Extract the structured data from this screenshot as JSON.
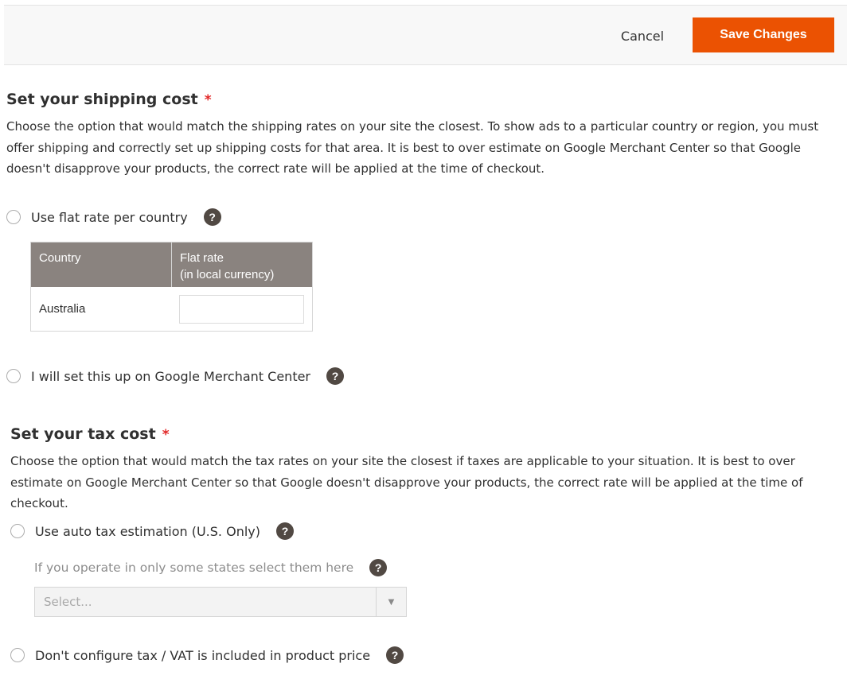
{
  "toolbar": {
    "cancel_label": "Cancel",
    "save_label": "Save Changes",
    "accent_color": "#eb5202"
  },
  "shipping": {
    "title": "Set your shipping cost",
    "required_marker": "*",
    "description": "Choose the option that would match the shipping rates on your site the closest. To show ads to a particular country or region, you must offer shipping and correctly set up shipping costs for that area. It is best to over estimate on Google Merchant Center so that Google doesn't disapprove your products, the correct rate will be applied at the time of checkout.",
    "option_flat_rate": "Use flat rate per country",
    "table": {
      "col_country": "Country",
      "col_rate_line1": "Flat rate",
      "col_rate_line2": "(in local currency)",
      "rows": [
        {
          "country": "Australia",
          "rate": ""
        }
      ]
    },
    "option_merchant_center": "I will set this up on Google Merchant Center"
  },
  "tax": {
    "title": "Set your tax cost",
    "required_marker": "*",
    "description": "Choose the option that would match the tax rates on your site the closest if taxes are applicable to your situation. It is best to over estimate on Google Merchant Center so that Google doesn't disapprove your products, the correct rate will be applied at the time of checkout.",
    "option_auto": "Use auto tax estimation (U.S. Only)",
    "states_label": "If you operate in only some states select them here",
    "states_placeholder": "Select...",
    "option_no_config": "Don't configure tax / VAT is included in product price"
  },
  "icons": {
    "help_glyph": "?",
    "dropdown_glyph": "▼"
  }
}
